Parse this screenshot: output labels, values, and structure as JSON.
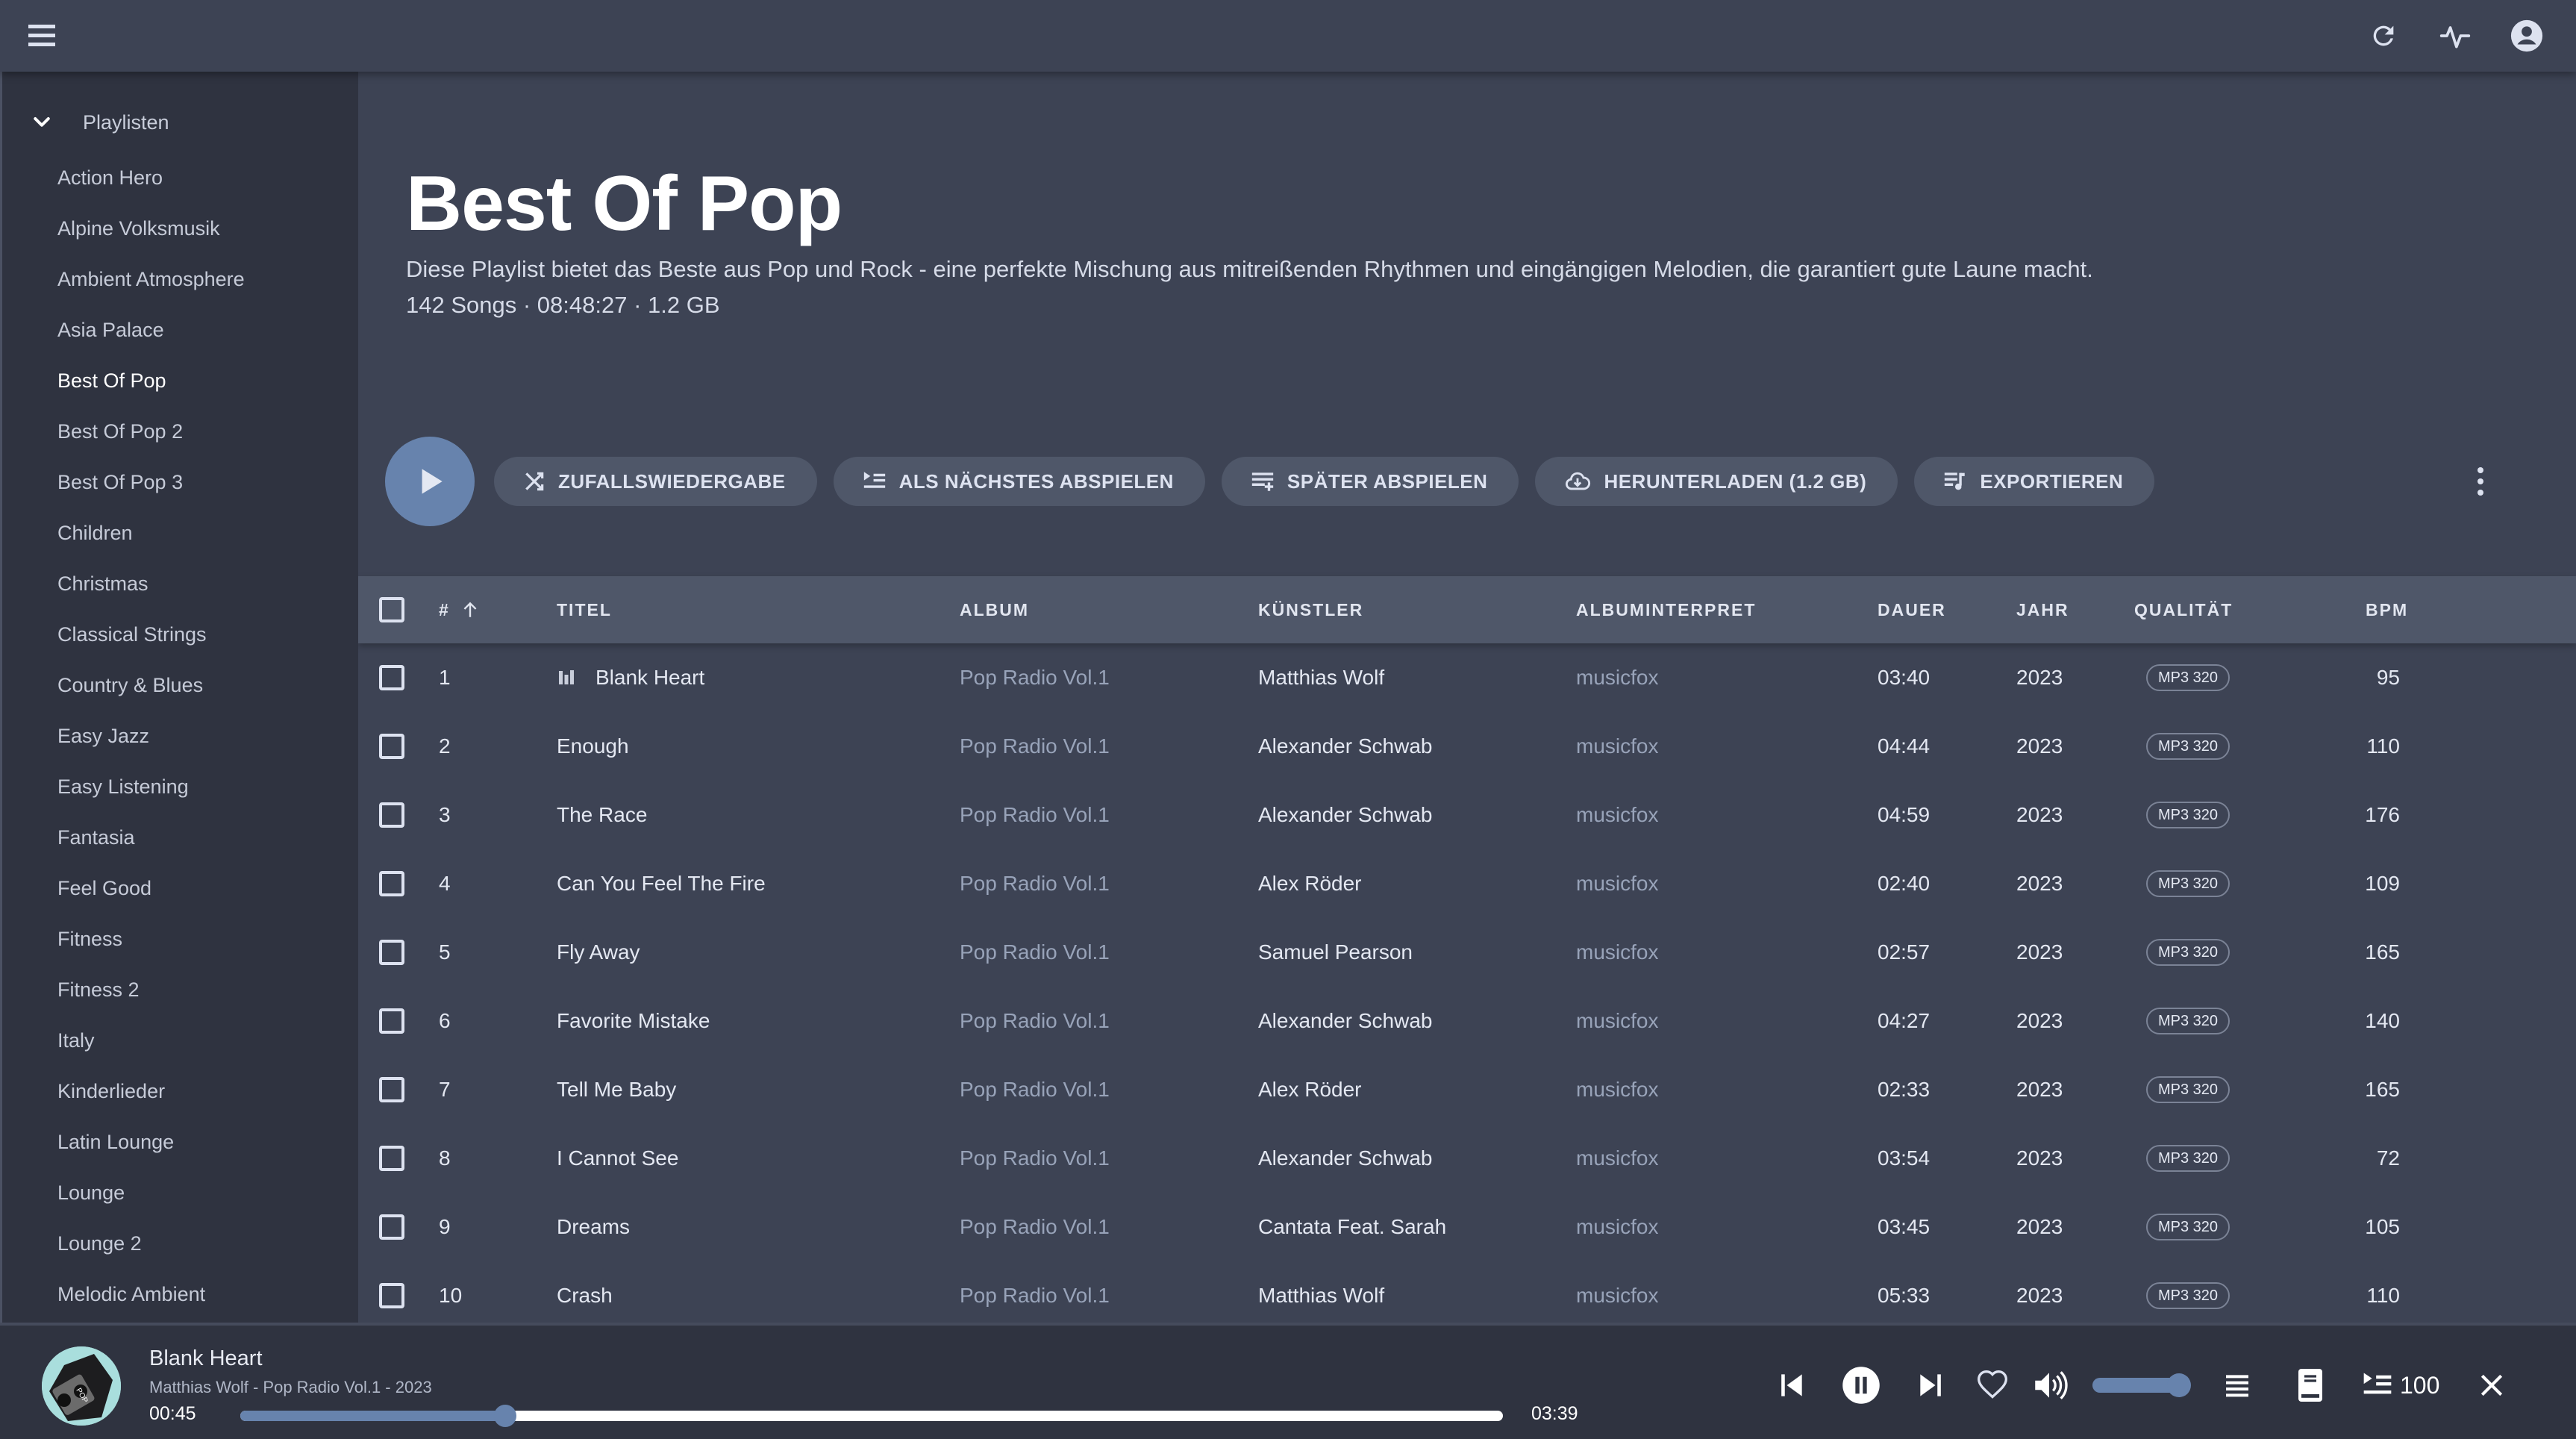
{
  "topbar": {
    "menu_icon": "hamburger-menu-icon",
    "icons": [
      "refresh-icon",
      "activity-icon",
      "account-circle-icon"
    ]
  },
  "sidebar": {
    "section_label": "Playlisten",
    "items": [
      {
        "label": "Action Hero"
      },
      {
        "label": "Alpine Volksmusik"
      },
      {
        "label": "Ambient Atmosphere"
      },
      {
        "label": "Asia Palace"
      },
      {
        "label": "Best Of Pop",
        "active": true
      },
      {
        "label": "Best Of Pop 2"
      },
      {
        "label": "Best Of Pop 3"
      },
      {
        "label": "Children"
      },
      {
        "label": "Christmas"
      },
      {
        "label": "Classical Strings"
      },
      {
        "label": "Country & Blues"
      },
      {
        "label": "Easy Jazz"
      },
      {
        "label": "Easy Listening"
      },
      {
        "label": "Fantasia"
      },
      {
        "label": "Feel Good"
      },
      {
        "label": "Fitness"
      },
      {
        "label": "Fitness 2"
      },
      {
        "label": "Italy"
      },
      {
        "label": "Kinderlieder"
      },
      {
        "label": "Latin Lounge"
      },
      {
        "label": "Lounge"
      },
      {
        "label": "Lounge 2"
      },
      {
        "label": "Melodic Ambient"
      }
    ]
  },
  "playlist": {
    "title": "Best Of Pop",
    "description": "Diese Playlist bietet das Beste aus Pop und Rock - eine perfekte Mischung aus mitreißenden Rhythmen und eingängigen Melodien, die garantiert gute Laune macht.",
    "meta": "142 Songs · 08:48:27 · 1.2 GB"
  },
  "actions": {
    "shuffle": "ZUFALLSWIEDERGABE",
    "play_next": "ALS NÄCHSTES ABSPIELEN",
    "play_later": "SPÄTER ABSPIELEN",
    "download": "HERUNTERLADEN (1.2 GB)",
    "export": "EXPORTIEREN"
  },
  "table": {
    "headers": {
      "num": "#",
      "title": "TITEL",
      "album": "ALBUM",
      "artist": "KÜNSTLER",
      "album_artist": "ALBUMINTERPRET",
      "duration": "DAUER",
      "year": "JAHR",
      "quality": "QUALITÄT",
      "bpm": "BPM"
    },
    "sort": {
      "column": "#",
      "direction": "ascending"
    },
    "rows": [
      {
        "num": "1",
        "title": "Blank Heart",
        "playing": true,
        "album": "Pop Radio Vol.1",
        "artist": "Matthias Wolf",
        "album_artist": "musicfox",
        "duration": "03:40",
        "year": "2023",
        "quality": "MP3 320",
        "bpm": "95"
      },
      {
        "num": "2",
        "title": "Enough",
        "album": "Pop Radio Vol.1",
        "artist": "Alexander Schwab",
        "album_artist": "musicfox",
        "duration": "04:44",
        "year": "2023",
        "quality": "MP3 320",
        "bpm": "110"
      },
      {
        "num": "3",
        "title": "The Race",
        "album": "Pop Radio Vol.1",
        "artist": "Alexander Schwab",
        "album_artist": "musicfox",
        "duration": "04:59",
        "year": "2023",
        "quality": "MP3 320",
        "bpm": "176"
      },
      {
        "num": "4",
        "title": "Can You Feel The Fire",
        "album": "Pop Radio Vol.1",
        "artist": "Alex Röder",
        "album_artist": "musicfox",
        "duration": "02:40",
        "year": "2023",
        "quality": "MP3 320",
        "bpm": "109"
      },
      {
        "num": "5",
        "title": "Fly Away",
        "album": "Pop Radio Vol.1",
        "artist": "Samuel Pearson",
        "album_artist": "musicfox",
        "duration": "02:57",
        "year": "2023",
        "quality": "MP3 320",
        "bpm": "165"
      },
      {
        "num": "6",
        "title": "Favorite Mistake",
        "album": "Pop Radio Vol.1",
        "artist": "Alexander Schwab",
        "album_artist": "musicfox",
        "duration": "04:27",
        "year": "2023",
        "quality": "MP3 320",
        "bpm": "140"
      },
      {
        "num": "7",
        "title": "Tell Me Baby",
        "album": "Pop Radio Vol.1",
        "artist": "Alex Röder",
        "album_artist": "musicfox",
        "duration": "02:33",
        "year": "2023",
        "quality": "MP3 320",
        "bpm": "165"
      },
      {
        "num": "8",
        "title": "I Cannot See",
        "album": "Pop Radio Vol.1",
        "artist": "Alexander Schwab",
        "album_artist": "musicfox",
        "duration": "03:54",
        "year": "2023",
        "quality": "MP3 320",
        "bpm": "72"
      },
      {
        "num": "9",
        "title": "Dreams",
        "album": "Pop Radio Vol.1",
        "artist": "Cantata Feat. Sarah",
        "album_artist": "musicfox",
        "duration": "03:45",
        "year": "2023",
        "quality": "MP3 320",
        "bpm": "105"
      },
      {
        "num": "10",
        "title": "Crash",
        "album": "Pop Radio Vol.1",
        "artist": "Matthias Wolf",
        "album_artist": "musicfox",
        "duration": "05:33",
        "year": "2023",
        "quality": "MP3 320",
        "bpm": "110"
      }
    ]
  },
  "player": {
    "title": "Blank Heart",
    "subtitle": "Matthias Wolf - Pop Radio Vol.1 - 2023",
    "current_time": "00:45",
    "total_time": "03:39",
    "progress_fraction": 0.21,
    "volume_fraction": 1.0,
    "queue_count": "100",
    "state": "playing"
  },
  "colors": {
    "accent": "#6783ad",
    "background": "#3d4354",
    "sidebar": "#2f3340",
    "pill": "#4f5769",
    "dim_text": "#98a3b9"
  }
}
